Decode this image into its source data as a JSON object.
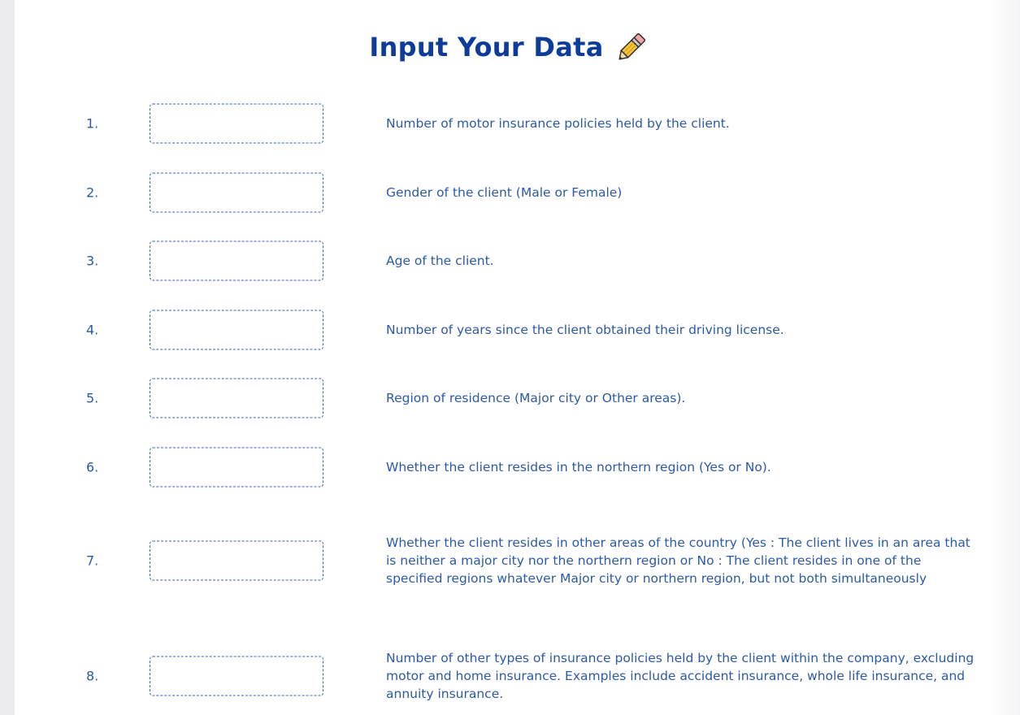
{
  "form": {
    "title": "Input Your Data",
    "title_icon": "pencil-icon",
    "fields": [
      {
        "number": "1.",
        "value": "",
        "description": "Number of motor insurance policies held by the client."
      },
      {
        "number": "2.",
        "value": "",
        "description": "Gender of the client (Male or Female)"
      },
      {
        "number": "3.",
        "value": "",
        "description": "Age of the client."
      },
      {
        "number": "4.",
        "value": "",
        "description": "Number of years since the client obtained their driving license."
      },
      {
        "number": "5.",
        "value": "",
        "description": "Region of residence (Major city or Other areas)."
      },
      {
        "number": "6.",
        "value": "",
        "description": "Whether the client resides in the northern region (Yes or No)."
      },
      {
        "number": "7.",
        "value": "",
        "description": "Whether the client resides in other areas of the country (Yes : The client lives in an area that is neither a major city nor the northern region or No : The client resides in one of the specified regions whatever Major city or northern region, but not both simultaneously"
      },
      {
        "number": "8.",
        "value": "",
        "description": "Number of other types of insurance policies held by the client within the company, excluding motor and home insurance. Examples include accident insurance, whole life insurance, and annuity insurance."
      }
    ]
  },
  "colors": {
    "title": "#0d3c9b",
    "text": "#2b5aa8",
    "border": "#3a64b6",
    "left_bar": "#ebebef"
  }
}
